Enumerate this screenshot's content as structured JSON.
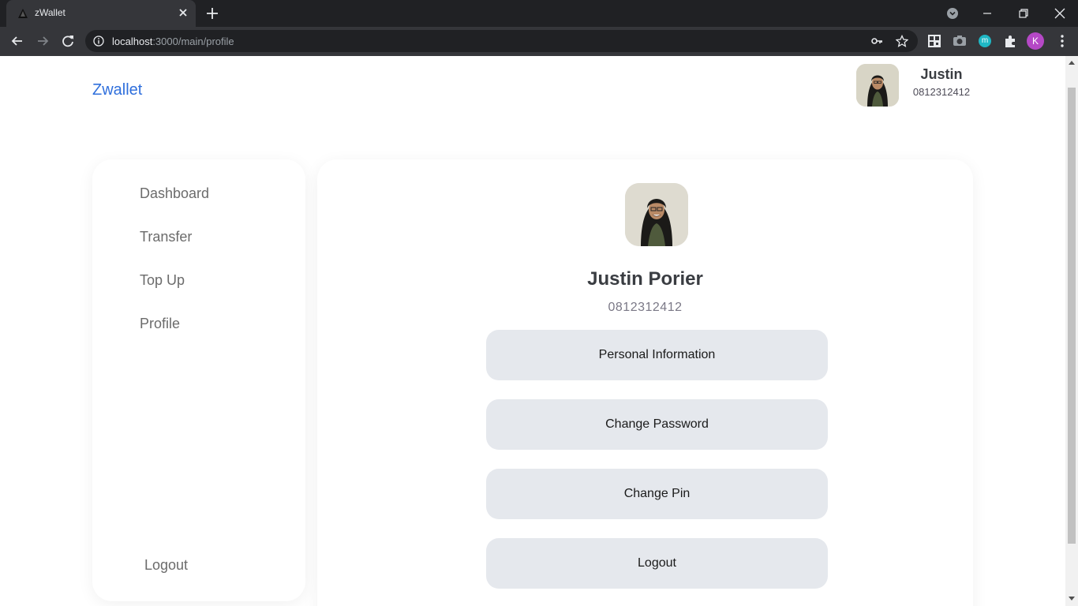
{
  "browser": {
    "tab_title": "zWallet",
    "url_host": "localhost",
    "url_path": ":3000/main/profile",
    "profile_initial": "K",
    "ext_m": "m"
  },
  "header": {
    "brand": "Zwallet",
    "user_name": "Justin",
    "user_phone": "0812312412"
  },
  "sidebar": {
    "items": [
      {
        "label": "Dashboard"
      },
      {
        "label": "Transfer"
      },
      {
        "label": "Top Up"
      },
      {
        "label": "Profile"
      }
    ],
    "logout_label": "Logout"
  },
  "profile": {
    "full_name": "Justin Porier",
    "phone": "0812312412",
    "buttons": [
      {
        "label": "Personal Information"
      },
      {
        "label": "Change Password"
      },
      {
        "label": "Change Pin"
      },
      {
        "label": "Logout"
      }
    ]
  },
  "colors": {
    "brand": "#2f6fdc",
    "button_bg": "#e5e8ed"
  }
}
